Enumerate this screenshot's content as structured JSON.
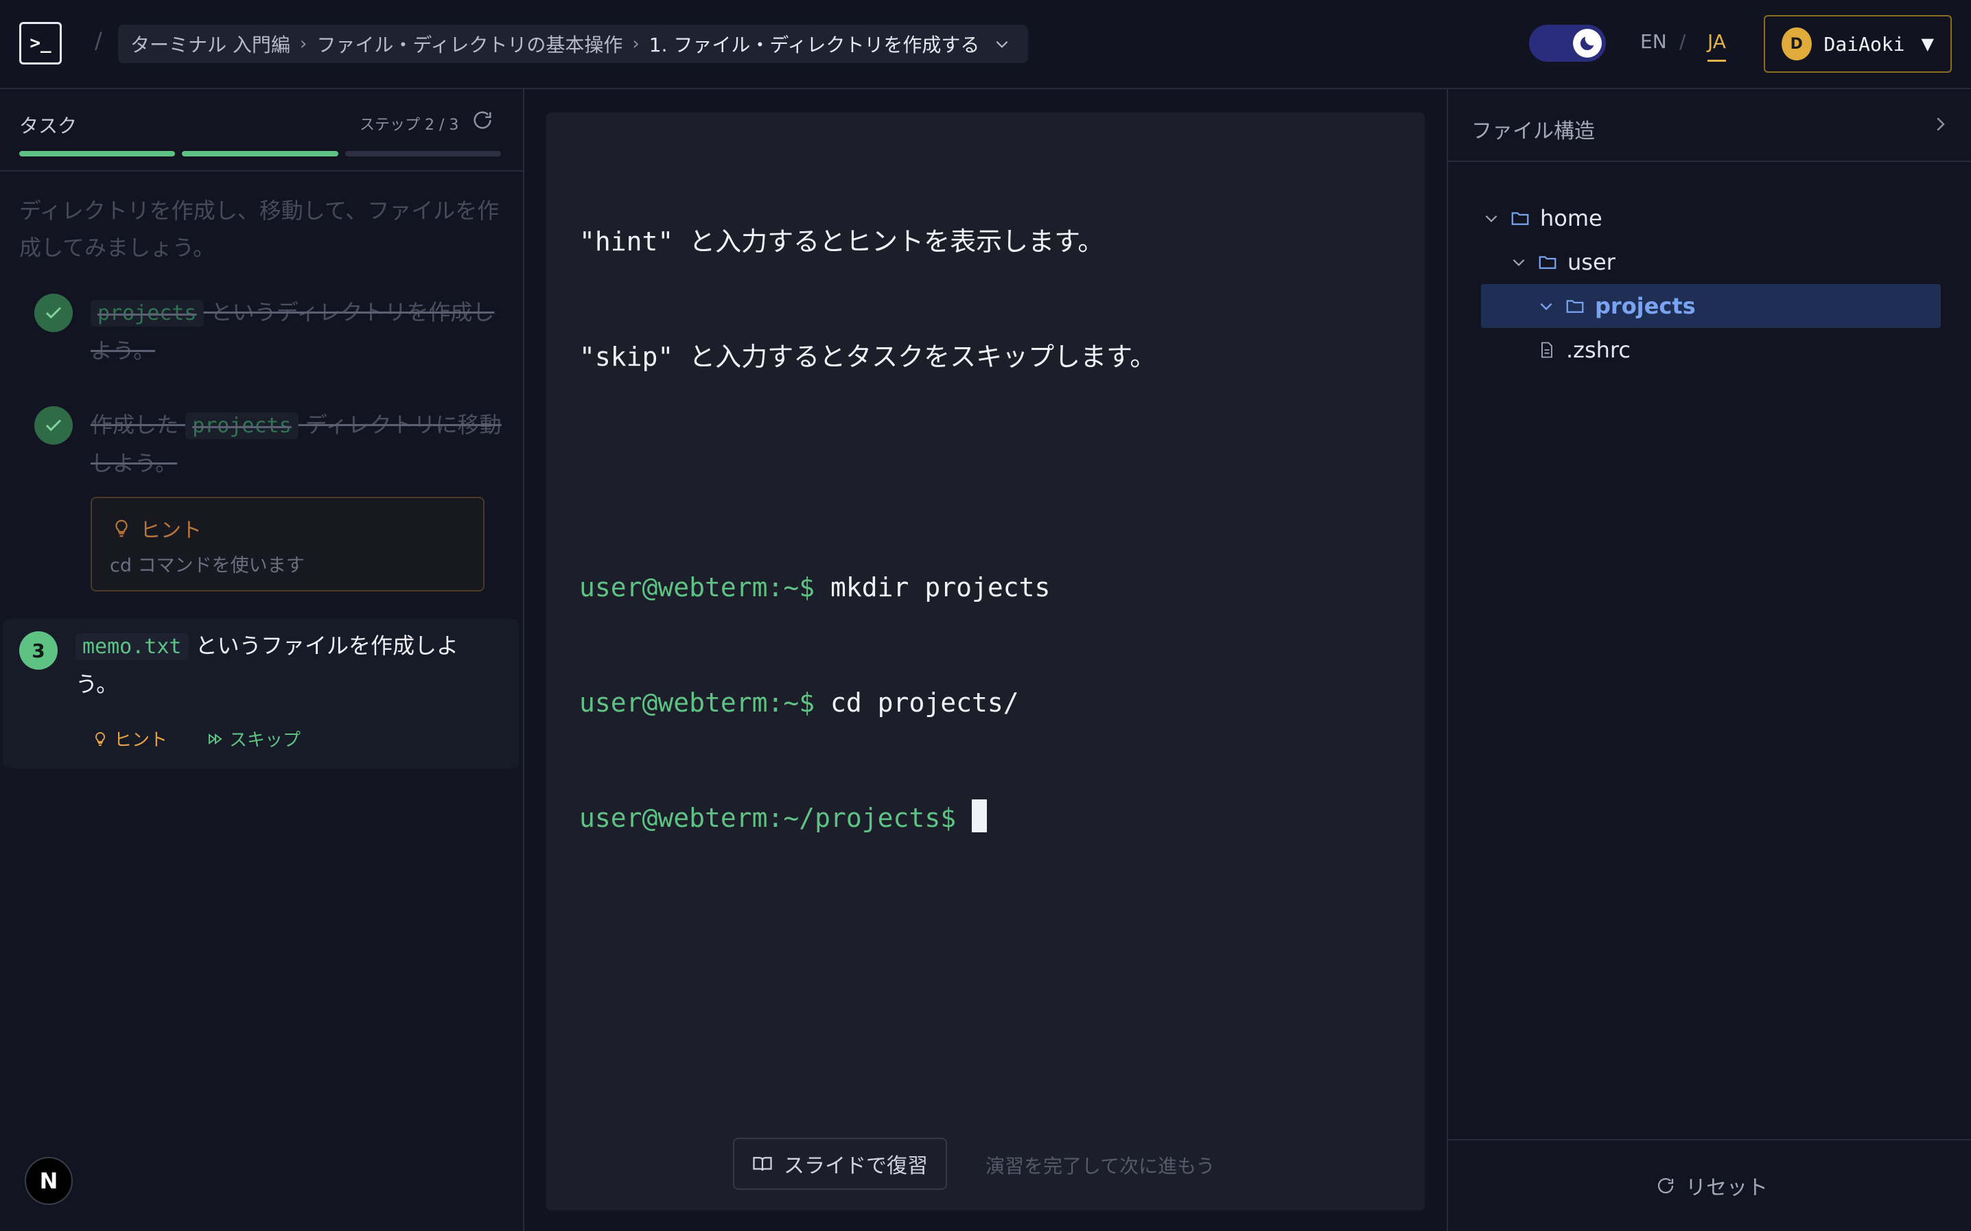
{
  "header": {
    "logo": ">_",
    "breadcrumb": {
      "items": [
        "ターミナル 入門編",
        "ファイル・ディレクトリの基本操作"
      ],
      "current": "1. ファイル・ディレクトリを作成する"
    },
    "lang": {
      "en": "EN",
      "sep": "/",
      "ja": "JA",
      "active": "JA"
    },
    "user": {
      "initial": "D",
      "name": "DaiAoki"
    }
  },
  "task": {
    "title": "タスク",
    "step_counter": "ステップ 2 / 3",
    "progress": {
      "completed": 2,
      "total": 3
    },
    "intro": "ディレクトリを作成し、移動して、ファイルを作成してみましょう。",
    "steps": [
      {
        "code": "projects",
        "text": " というディレクトリを作成しよう。",
        "status": "done"
      },
      {
        "pre": "作成した ",
        "code": "projects",
        "text": " ディレクトリに移動しよう。",
        "status": "done",
        "hint": {
          "label": "ヒント",
          "body": "cd コマンドを使います"
        }
      },
      {
        "number": "3",
        "code": "memo.txt",
        "text": " というファイルを作成しよう。",
        "status": "active",
        "hint_label": "ヒント",
        "skip_label": "スキップ"
      }
    ]
  },
  "terminal": {
    "intro_lines": [
      "\"hint\" と入力するとヒントを表示します。",
      "\"skip\" と入力するとタスクをスキップします。"
    ],
    "history": [
      {
        "prompt": "user@webterm:~$",
        "command": " mkdir projects"
      },
      {
        "prompt": "user@webterm:~$",
        "command": " cd projects/"
      }
    ],
    "current_prompt": "user@webterm:~/projects$",
    "slide_button": "スライドで復習",
    "next_message": "演習を完了して次に進もう"
  },
  "file_tree": {
    "title": "ファイル構造",
    "nodes": {
      "home": "home",
      "user": "user",
      "projects": "projects",
      "zshrc": ".zshrc"
    },
    "selected": "projects"
  },
  "reset_label": "リセット",
  "badge": "N",
  "colors": {
    "accent_green": "#5fc285",
    "accent_gold": "#e2b249",
    "selected_folder": "#7aa3f1",
    "background": "#111320"
  }
}
